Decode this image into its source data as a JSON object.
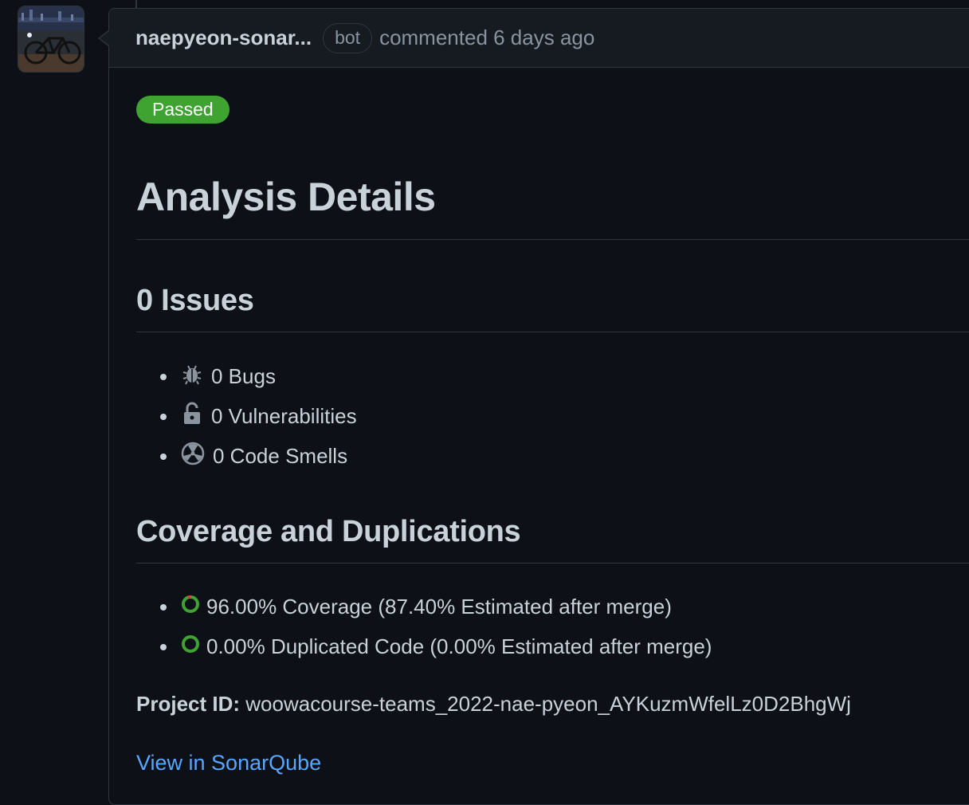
{
  "comment": {
    "author": "naepyeon-sonar...",
    "author_badge": "bot",
    "meta": "commented 6 days ago"
  },
  "status": {
    "label": "Passed",
    "color": "#3fa332"
  },
  "analysis": {
    "title": "Analysis Details",
    "issues": {
      "heading": "0 Issues",
      "items": [
        {
          "icon": "bug-icon",
          "text": "0 Bugs"
        },
        {
          "icon": "unlocked-icon",
          "text": "0 Vulnerabilities"
        },
        {
          "icon": "code-smell-icon",
          "text": "0 Code Smells"
        }
      ]
    },
    "coverage": {
      "heading": "Coverage and Duplications",
      "items": [
        {
          "icon": "coverage-ring-icon",
          "text": "96.00% Coverage (87.40% Estimated after merge)"
        },
        {
          "icon": "duplication-ring-icon",
          "text": "0.00% Duplicated Code (0.00% Estimated after merge)"
        }
      ]
    },
    "project": {
      "label": "Project ID:",
      "value": "woowacourse-teams_2022-nae-pyeon_AYKuzmWfelLz0D2BhgWj"
    },
    "link": "View in SonarQube"
  },
  "colors": {
    "background": "#0d1117",
    "header": "#161b22",
    "border": "#30363d",
    "link": "#58a6ff",
    "ring": "#3fa332"
  }
}
